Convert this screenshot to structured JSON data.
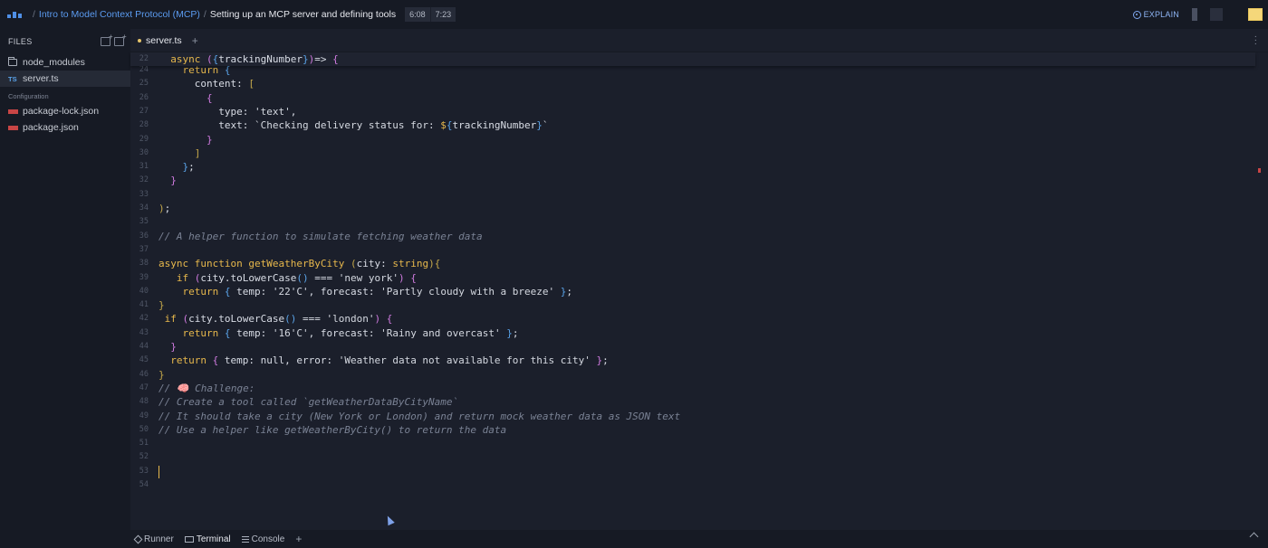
{
  "breadcrumb": {
    "course": "Intro to Model Context Protocol (MCP)",
    "lesson": "Setting up an MCP server and defining tools",
    "time_current": "6:08",
    "time_total": "7:23"
  },
  "header": {
    "explain_label": "EXPLAIN",
    "accent_color": "#5b9bf0"
  },
  "sidebar": {
    "title": "FILES",
    "items": [
      {
        "label": "node_modules",
        "icon": "folder-icon"
      },
      {
        "label": "server.ts",
        "icon": "typescript-icon",
        "badge": "TS"
      }
    ],
    "section_label": "Configuration",
    "config_items": [
      {
        "label": "package-lock.json",
        "icon": "npm-icon"
      },
      {
        "label": "package.json",
        "icon": "npm-icon"
      }
    ]
  },
  "editor": {
    "tab_label": "server.ts",
    "lines": [
      {
        "n": "22",
        "html": "  <span class='k'>async</span> <span class='bp'>(</span><span class='bb'>{</span><span class='p'>trackingNumber</span><span class='bb'>}</span><span class='bp'>)</span><span class='p'>=></span> <span class='bp'>{</span>"
      },
      {
        "n": "24",
        "html": "    <span class='k'>return</span> <span class='bb'>{</span>"
      },
      {
        "n": "25",
        "html": "      <span class='p'>content:</span> <span class='br'>[</span>"
      },
      {
        "n": "26",
        "html": "        <span class='bp'>{</span>"
      },
      {
        "n": "27",
        "html": "          <span class='p'>type:</span> <span class='s'>'text'</span><span class='p'>,</span>"
      },
      {
        "n": "28",
        "html": "          <span class='p'>text:</span> <span class='s'>`Checking delivery status for: </span><span class='k'>$</span><span class='bb'>{</span><span class='p'>trackingNumber</span><span class='bb'>}</span><span class='s'>`</span>"
      },
      {
        "n": "29",
        "html": "        <span class='bp'>}</span>"
      },
      {
        "n": "30",
        "html": "      <span class='br'>]</span>"
      },
      {
        "n": "31",
        "html": "    <span class='bb'>}</span><span class='p'>;</span>"
      },
      {
        "n": "32",
        "html": "  <span class='bp'>}</span>"
      },
      {
        "n": "33",
        "html": ""
      },
      {
        "n": "34",
        "html": "<span class='br'>)</span><span class='p'>;</span>"
      },
      {
        "n": "35",
        "html": ""
      },
      {
        "n": "36",
        "html": "<span class='c'>// A helper function to simulate fetching weather data</span>"
      },
      {
        "n": "37",
        "html": ""
      },
      {
        "n": "38",
        "html": "<span class='k'>async</span> <span class='k'>function</span> <span class='f'>getWeatherByCity</span> <span class='br'>(</span><span class='p'>city: </span><span class='k'>string</span><span class='br'>)</span><span class='br'>{</span>"
      },
      {
        "n": "39",
        "html": "   <span class='k'>if</span> <span class='bp'>(</span><span class='p'>city.toLowerCase</span><span class='bb'>()</span> <span class='p'>===</span> <span class='s'>'new york'</span><span class='bp'>)</span> <span class='bp'>{</span>"
      },
      {
        "n": "40",
        "html": "    <span class='k'>return</span> <span class='bb'>{</span> <span class='p'>temp:</span> <span class='s'>'22'C'</span><span class='p'>, forecast:</span> <span class='s'>'Partly cloudy with a breeze'</span> <span class='bb'>}</span><span class='p'>;</span>"
      },
      {
        "n": "41",
        "html": "<span class='br'>}</span>"
      },
      {
        "n": "42",
        "html": " <span class='k'>if</span> <span class='bp'>(</span><span class='p'>city.toLowerCase</span><span class='bb'>()</span> <span class='p'>===</span> <span class='s'>'london'</span><span class='bp'>)</span> <span class='bp'>{</span>"
      },
      {
        "n": "43",
        "html": "    <span class='k'>return</span> <span class='bb'>{</span> <span class='p'>temp:</span> <span class='s'>'16'C'</span><span class='p'>, forecast:</span> <span class='s'>'Rainy and overcast'</span> <span class='bb'>}</span><span class='p'>;</span>"
      },
      {
        "n": "44",
        "html": "  <span class='bp'>}</span>"
      },
      {
        "n": "45",
        "html": "  <span class='k'>return</span> <span class='bp'>{</span> <span class='p'>temp: null, error:</span> <span class='s'>'Weather data not available for this city'</span> <span class='bp'>}</span><span class='p'>;</span>"
      },
      {
        "n": "46",
        "html": "<span class='br'>}</span>"
      },
      {
        "n": "47",
        "html": "<span class='c'>// 🧠 Challenge:</span>"
      },
      {
        "n": "48",
        "html": "<span class='c'>// Create a tool called `getWeatherDataByCityName`</span>"
      },
      {
        "n": "49",
        "html": "<span class='c'>// It should take a city (New York or London) and return mock weather data as JSON text</span>"
      },
      {
        "n": "50",
        "html": "<span class='c'>// Use a helper like getWeatherByCity() to return the data</span>"
      },
      {
        "n": "51",
        "html": ""
      },
      {
        "n": "52",
        "html": ""
      },
      {
        "n": "53",
        "html": ""
      },
      {
        "n": "54",
        "html": ""
      }
    ]
  },
  "bottom_panel": {
    "tabs": [
      {
        "label": "Runner",
        "icon": "runner-icon"
      },
      {
        "label": "Terminal",
        "icon": "terminal-icon"
      },
      {
        "label": "Console",
        "icon": "console-icon"
      }
    ]
  }
}
